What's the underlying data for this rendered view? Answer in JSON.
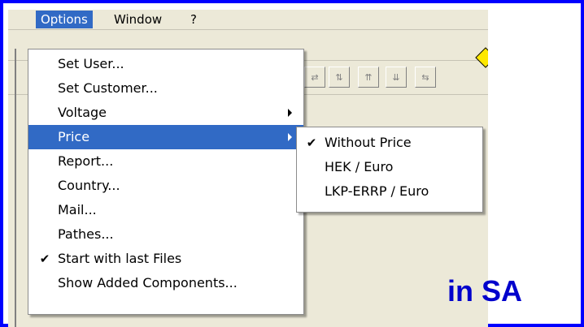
{
  "menubar": {
    "items": [
      {
        "label": "Options"
      },
      {
        "label": "Window"
      },
      {
        "label": "?"
      }
    ]
  },
  "options_menu": {
    "items": [
      {
        "label": "Set User...",
        "checked": false,
        "submenu": false
      },
      {
        "label": "Set Customer...",
        "checked": false,
        "submenu": false
      },
      {
        "label": "Voltage",
        "checked": false,
        "submenu": true
      },
      {
        "label": "Price",
        "checked": false,
        "submenu": true,
        "active": true
      },
      {
        "label": "Report...",
        "checked": false,
        "submenu": false
      },
      {
        "label": "Country...",
        "checked": false,
        "submenu": false
      },
      {
        "label": "Mail...",
        "checked": false,
        "submenu": false
      },
      {
        "label": "Pathes...",
        "checked": false,
        "submenu": false
      },
      {
        "label": "Start with last Files",
        "checked": true,
        "submenu": false
      },
      {
        "label": "Show Added Components...",
        "checked": false,
        "submenu": false
      }
    ],
    "check_glyph": "✔"
  },
  "price_submenu": {
    "items": [
      {
        "label": "Without Price",
        "checked": true
      },
      {
        "label": "HEK / Euro",
        "checked": false
      },
      {
        "label": "LKP-ERRP / Euro",
        "checked": false
      }
    ]
  },
  "annotation": {
    "text": "in SA"
  },
  "colors": {
    "frame": "#0000ff",
    "highlight": "#316ac5",
    "annotation": "#0000cc",
    "menu_bg": "#ffffff",
    "chrome_bg": "#ece9d8"
  },
  "icons": [
    "checkmark-icon",
    "submenu-arrow-icon",
    "toolbar-button-icon"
  ]
}
